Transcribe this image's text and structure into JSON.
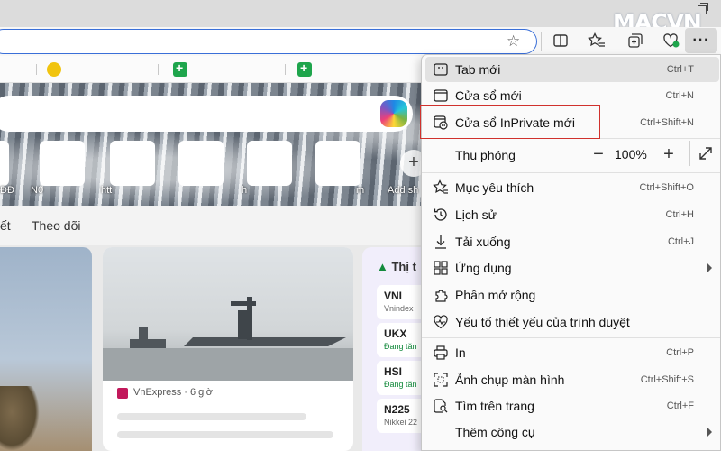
{
  "watermark": "MACVN",
  "toolbar": {
    "icons": [
      "split-screen-icon",
      "favorites-icon",
      "collections-icon",
      "browser-essentials-icon",
      "more-icon"
    ],
    "more_label": "···"
  },
  "new_tab": {
    "tiles": [
      "ĐĐ",
      "N0",
      "htt",
      "",
      "h",
      "m",
      "Add sh"
    ],
    "feed_tabs": [
      "ết",
      "Theo dõi"
    ],
    "article_source": "VnExpress · 6 giờ",
    "markets": {
      "title": "Thị t",
      "rows": [
        {
          "symbol": "VNI",
          "sub": "Vnindex",
          "trend": "none"
        },
        {
          "symbol": "UKX",
          "sub": "Đang tăn",
          "trend": "up"
        },
        {
          "symbol": "HSI",
          "sub": "Đang tăn",
          "trend": "up"
        },
        {
          "symbol": "N225",
          "sub": "Nikkei 22",
          "trend": "none"
        }
      ]
    }
  },
  "menu": {
    "items": [
      {
        "label": "Tab mới",
        "shortcut": "Ctrl+T",
        "icon": "new-tab-icon",
        "highlighted": true
      },
      {
        "label": "Cửa sổ mới",
        "shortcut": "Ctrl+N",
        "icon": "new-window-icon"
      },
      {
        "label": "Cửa sổ InPrivate mới",
        "shortcut": "Ctrl+Shift+N",
        "icon": "inprivate-window-icon",
        "outlined": true
      },
      {
        "label": "Thu phóng",
        "zoom_value": "100%",
        "icon": "none"
      },
      {
        "label": "Mục yêu thích",
        "shortcut": "Ctrl+Shift+O",
        "icon": "favorites-icon"
      },
      {
        "label": "Lịch sử",
        "shortcut": "Ctrl+H",
        "icon": "history-icon"
      },
      {
        "label": "Tải xuống",
        "shortcut": "Ctrl+J",
        "icon": "download-icon"
      },
      {
        "label": "Ứng dụng",
        "shortcut": "",
        "icon": "apps-icon",
        "submenu": true
      },
      {
        "label": "Phần mở rộng",
        "shortcut": "",
        "icon": "extensions-icon"
      },
      {
        "label": "Yếu tố thiết yếu của trình duyệt",
        "shortcut": "",
        "icon": "browser-essentials-icon"
      },
      {
        "label": "In",
        "shortcut": "Ctrl+P",
        "icon": "print-icon"
      },
      {
        "label": "Ảnh chụp màn hình",
        "shortcut": "Ctrl+Shift+S",
        "icon": "screenshot-icon"
      },
      {
        "label": "Tìm trên trang",
        "shortcut": "Ctrl+F",
        "icon": "find-icon"
      },
      {
        "label": "Thêm công cụ",
        "shortcut": "",
        "icon": "more-tools-icon",
        "submenu": true
      }
    ],
    "zoom": {
      "minus": "−",
      "value": "100%",
      "plus": "+"
    },
    "outline_color": "#d0312d"
  }
}
